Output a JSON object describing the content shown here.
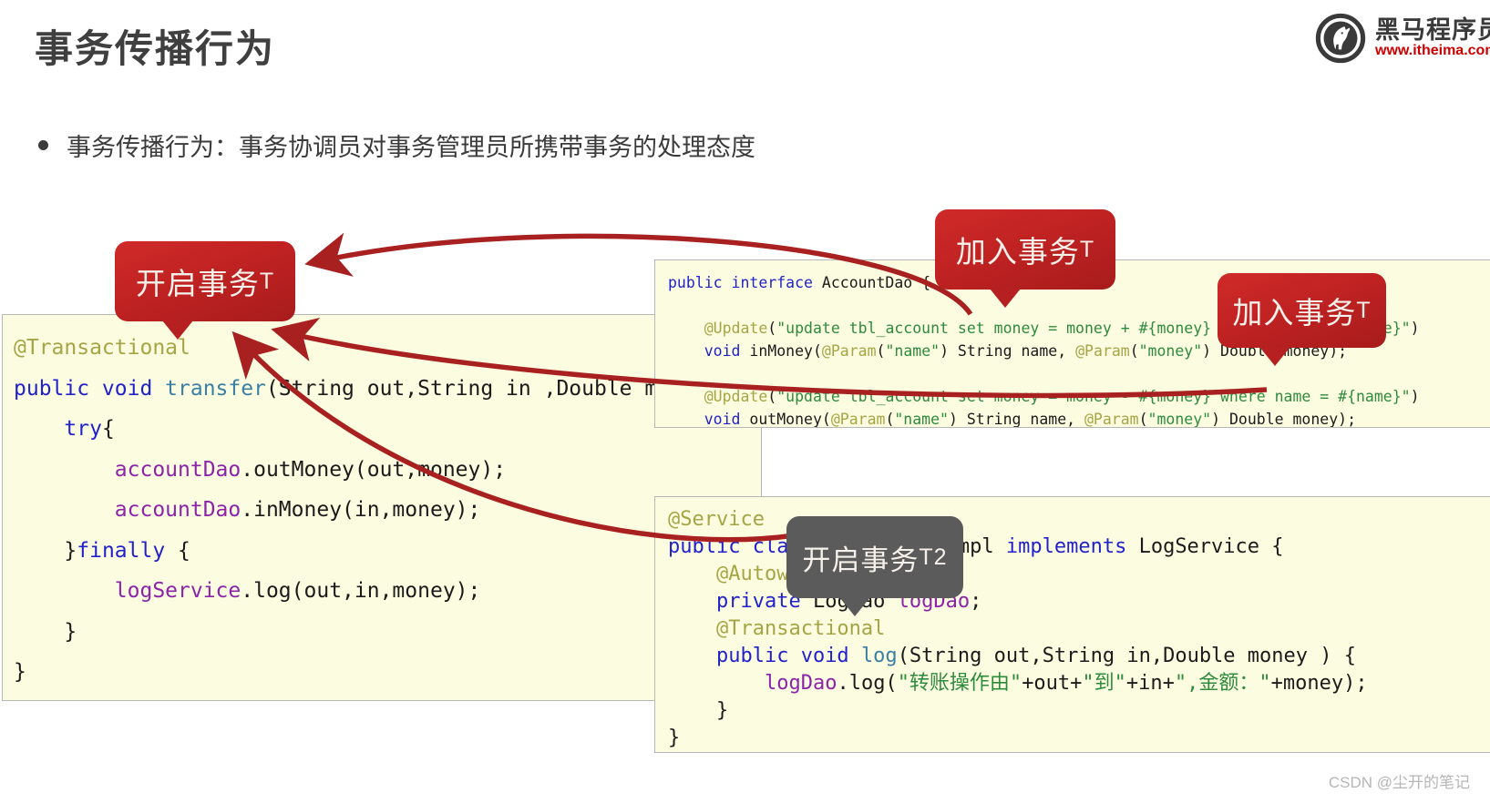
{
  "header": {
    "title": "事务传播行为",
    "logo": {
      "icon": "horse-head-circle-logo",
      "brand_cn": "黑马程序员",
      "url": "www.itheima.com"
    }
  },
  "bullet": {
    "marker": "bullet-dot-icon",
    "text": "事务传播行为：事务协调员对事务管理员所携带事务的处理态度"
  },
  "code_blocks": {
    "transfer": {
      "lines": [
        [
          {
            "t": "@Transactional",
            "c": "t-ann"
          }
        ],
        [
          {
            "t": "public void ",
            "c": "t-kw"
          },
          {
            "t": "transfer",
            "c": "t-meth"
          },
          {
            "t": "(String out,String in ,Double money){",
            "c": "t-plain"
          }
        ],
        [
          {
            "t": "    ",
            "c": "t-plain"
          },
          {
            "t": "try",
            "c": "t-kw"
          },
          {
            "t": "{",
            "c": "t-plain"
          }
        ],
        [
          {
            "t": "        ",
            "c": "t-plain"
          },
          {
            "t": "accountDao",
            "c": "t-field"
          },
          {
            "t": ".outMoney(out,money);",
            "c": "t-plain"
          }
        ],
        [
          {
            "t": "        ",
            "c": "t-plain"
          },
          {
            "t": "accountDao",
            "c": "t-field"
          },
          {
            "t": ".inMoney(in,money);",
            "c": "t-plain"
          }
        ],
        [
          {
            "t": "    }",
            "c": "t-plain"
          },
          {
            "t": "finally",
            "c": "t-kw"
          },
          {
            "t": " {",
            "c": "t-plain"
          }
        ],
        [
          {
            "t": "        ",
            "c": "t-plain"
          },
          {
            "t": "logService",
            "c": "t-field"
          },
          {
            "t": ".log(out,in,money);",
            "c": "t-plain"
          }
        ],
        [
          {
            "t": "    }",
            "c": "t-plain"
          }
        ],
        [
          {
            "t": "}",
            "c": "t-plain"
          }
        ]
      ]
    },
    "account_dao": {
      "lines": [
        [
          {
            "t": "public interface ",
            "c": "t-kw"
          },
          {
            "t": "AccountDao {",
            "c": "t-plain"
          }
        ],
        [],
        [
          {
            "t": "    ",
            "c": "t-plain"
          },
          {
            "t": "@Update",
            "c": "t-ann"
          },
          {
            "t": "(",
            "c": "t-plain"
          },
          {
            "t": "\"update tbl_account set money = money + #{money} where name = #{name}\"",
            "c": "t-str"
          },
          {
            "t": ")",
            "c": "t-plain"
          }
        ],
        [
          {
            "t": "    ",
            "c": "t-plain"
          },
          {
            "t": "void ",
            "c": "t-kw"
          },
          {
            "t": "inMoney(",
            "c": "t-plain"
          },
          {
            "t": "@Param",
            "c": "t-ann"
          },
          {
            "t": "(",
            "c": "t-plain"
          },
          {
            "t": "\"name\"",
            "c": "t-str"
          },
          {
            "t": ") String name, ",
            "c": "t-plain"
          },
          {
            "t": "@Param",
            "c": "t-ann"
          },
          {
            "t": "(",
            "c": "t-plain"
          },
          {
            "t": "\"money\"",
            "c": "t-str"
          },
          {
            "t": ") Double money);",
            "c": "t-plain"
          }
        ],
        [],
        [
          {
            "t": "    ",
            "c": "t-plain"
          },
          {
            "t": "@Update",
            "c": "t-ann"
          },
          {
            "t": "(",
            "c": "t-plain"
          },
          {
            "t": "\"update tbl_account set money = money - #{money} where name = #{name}\"",
            "c": "t-str"
          },
          {
            "t": ")",
            "c": "t-plain"
          }
        ],
        [
          {
            "t": "    ",
            "c": "t-plain"
          },
          {
            "t": "void ",
            "c": "t-kw"
          },
          {
            "t": "outMoney(",
            "c": "t-plain"
          },
          {
            "t": "@Param",
            "c": "t-ann"
          },
          {
            "t": "(",
            "c": "t-plain"
          },
          {
            "t": "\"name\"",
            "c": "t-str"
          },
          {
            "t": ") String name, ",
            "c": "t-plain"
          },
          {
            "t": "@Param",
            "c": "t-ann"
          },
          {
            "t": "(",
            "c": "t-plain"
          },
          {
            "t": "\"money\"",
            "c": "t-str"
          },
          {
            "t": ") Double money);",
            "c": "t-plain"
          }
        ],
        [
          {
            "t": "}",
            "c": "t-plain"
          }
        ]
      ]
    },
    "log_service": {
      "lines": [
        [
          {
            "t": "@Service",
            "c": "t-ann"
          }
        ],
        [
          {
            "t": "public class ",
            "c": "t-kw"
          },
          {
            "t": "LogServiceImpl ",
            "c": "t-plain"
          },
          {
            "t": "implements ",
            "c": "t-kw"
          },
          {
            "t": "LogService {",
            "c": "t-plain"
          }
        ],
        [
          {
            "t": "    ",
            "c": "t-plain"
          },
          {
            "t": "@Autowired",
            "c": "t-ann"
          }
        ],
        [
          {
            "t": "    ",
            "c": "t-plain"
          },
          {
            "t": "private ",
            "c": "t-kw"
          },
          {
            "t": "LogDao ",
            "c": "t-plain"
          },
          {
            "t": "logDao",
            "c": "t-field"
          },
          {
            "t": ";",
            "c": "t-plain"
          }
        ],
        [
          {
            "t": "    ",
            "c": "t-plain"
          },
          {
            "t": "@Transactional",
            "c": "t-ann"
          }
        ],
        [
          {
            "t": "    ",
            "c": "t-plain"
          },
          {
            "t": "public void ",
            "c": "t-kw"
          },
          {
            "t": "log",
            "c": "t-meth"
          },
          {
            "t": "(String out,String in,Double money ) {",
            "c": "t-plain"
          }
        ],
        [
          {
            "t": "        ",
            "c": "t-plain"
          },
          {
            "t": "logDao",
            "c": "t-field"
          },
          {
            "t": ".log(",
            "c": "t-plain"
          },
          {
            "t": "\"转账操作由\"",
            "c": "t-str"
          },
          {
            "t": "+out+",
            "c": "t-plain"
          },
          {
            "t": "\"到\"",
            "c": "t-str"
          },
          {
            "t": "+in+",
            "c": "t-plain"
          },
          {
            "t": "\",金额：\"",
            "c": "t-str"
          },
          {
            "t": "+money);",
            "c": "t-plain"
          }
        ],
        [
          {
            "t": "    }",
            "c": "t-plain"
          }
        ],
        [
          {
            "t": "}",
            "c": "t-plain"
          }
        ]
      ]
    }
  },
  "callouts": [
    {
      "id": "open-t",
      "label": "开启事务",
      "suffix": "T",
      "style": "red"
    },
    {
      "id": "join-t1",
      "label": "加入事务",
      "suffix": "T",
      "style": "red"
    },
    {
      "id": "join-t2",
      "label": "加入事务",
      "suffix": "T",
      "style": "red"
    },
    {
      "id": "open-t2",
      "label": "开启事务",
      "suffix": "T2",
      "style": "gray"
    }
  ],
  "colors": {
    "callout_red": "#b62020",
    "callout_gray": "#5b5b5b",
    "arrow_red": "#a82020",
    "code_bg": "#fcfce0",
    "title": "#3f3f3f",
    "brand_red": "#cc0000"
  },
  "watermark": "CSDN @尘开的笔记"
}
